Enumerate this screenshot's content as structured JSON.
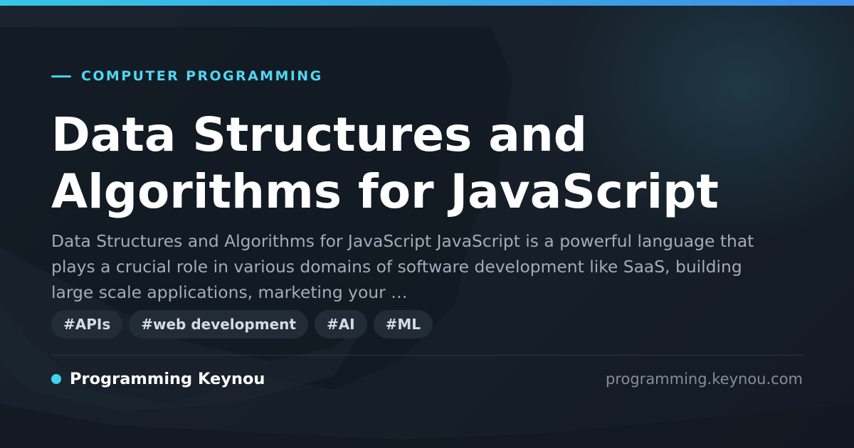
{
  "colors": {
    "accent": "#3fd3f0",
    "accent_gradient_end": "#3f8fe8",
    "background": "#17202a",
    "title": "#ffffff",
    "description": "#a3acb7",
    "tag_background": "#222c37",
    "muted": "#858e99"
  },
  "card": {
    "category": "COMPUTER PROGRAMMING",
    "title": "Data Structures and Algorithms for JavaScript",
    "description": "Data Structures and Algorithms for JavaScript JavaScript is a powerful language that plays a crucial role in various domains of software development like SaaS, building large scale applications, marketing your …",
    "tags": [
      "#APIs",
      "#web development",
      "#AI",
      "#ML"
    ]
  },
  "footer": {
    "brand_icon": "dot-icon",
    "brand_name": "Programming Keynou",
    "domain": "programming.keynou.com"
  }
}
